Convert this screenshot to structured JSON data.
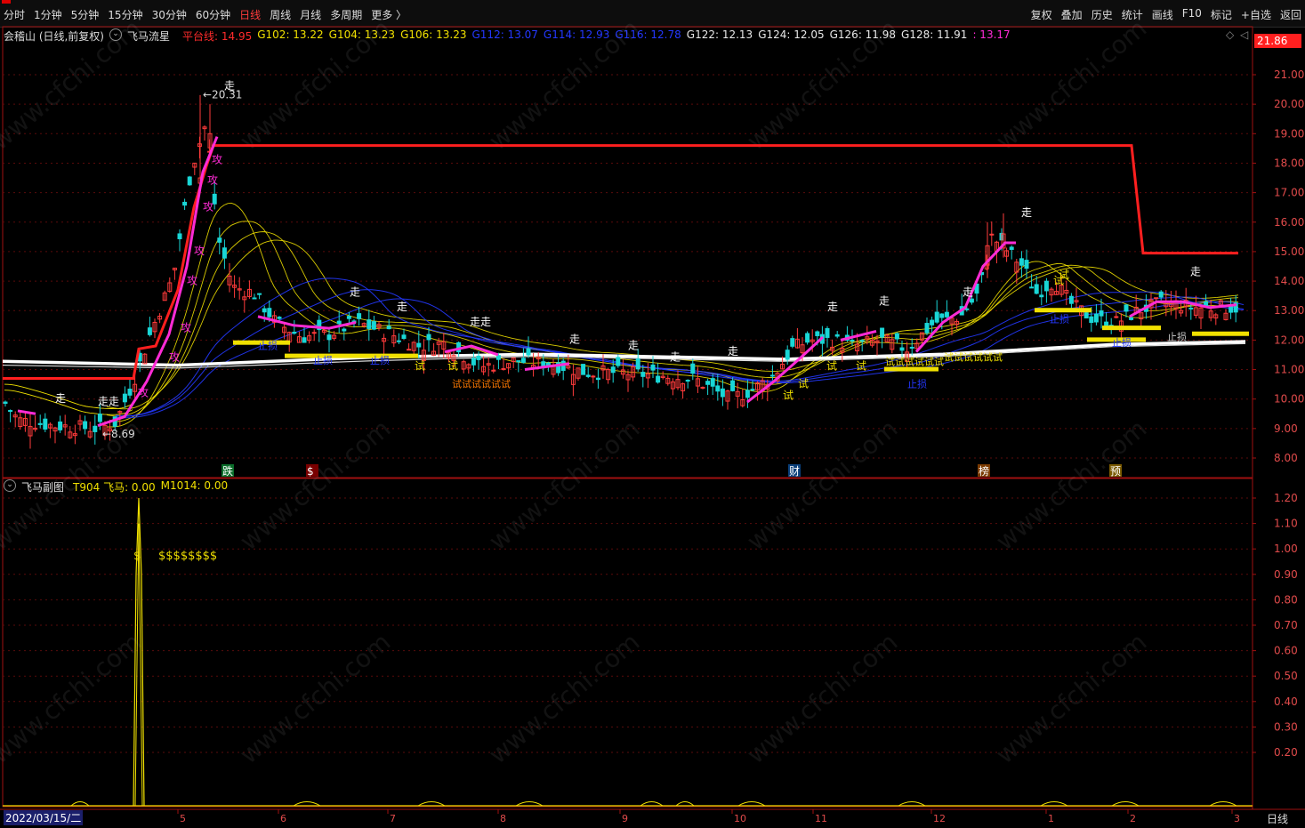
{
  "toolbar": {
    "left": [
      "分时",
      "1分钟",
      "5分钟",
      "15分钟",
      "30分钟",
      "60分钟",
      "日线",
      "周线",
      "月线",
      "多周期",
      "更多 〉"
    ],
    "active": "日线",
    "right": [
      "复权",
      "叠加",
      "历史",
      "统计",
      "画线",
      "F10",
      "标记",
      "+自选",
      "返回"
    ]
  },
  "main_info": {
    "stock": "会稽山 (日线,前复权)",
    "indicator": "飞马流星",
    "platform_label": "平台线: 14.95",
    "g_values": [
      {
        "text": "G102: 13.22",
        "color": "#f0e000"
      },
      {
        "text": "G104: 13.23",
        "color": "#f0e000"
      },
      {
        "text": "G106: 13.23",
        "color": "#f0e000"
      },
      {
        "text": "G112: 13.07",
        "color": "#2438ff"
      },
      {
        "text": "G114: 12.93",
        "color": "#2438ff"
      },
      {
        "text": "G116: 12.78",
        "color": "#2438ff"
      },
      {
        "text": "G122: 12.13",
        "color": "#e8e8e8"
      },
      {
        "text": "G124: 12.05",
        "color": "#e8e8e8"
      },
      {
        "text": "G126: 11.98",
        "color": "#e8e8e8"
      },
      {
        "text": "G128: 11.91",
        "color": "#e8e8e8"
      },
      {
        "text": ": 13.17",
        "color": "#ff2bd6"
      }
    ],
    "current_price": "21.86"
  },
  "sub_info": {
    "title": "飞马副图",
    "t904": "T904 飞马: 0.00",
    "m1014": "M1014: 0.00"
  },
  "main_ticks": [
    "21.00",
    "20.00",
    "19.00",
    "18.00",
    "17.00",
    "16.00",
    "15.00",
    "14.00",
    "13.00",
    "12.00",
    "11.00",
    "10.00",
    "9.00",
    "8.00"
  ],
  "sub_ticks": [
    "1.20",
    "1.10",
    "1.00",
    "0.90",
    "0.80",
    "0.70",
    "0.60",
    "0.50",
    "0.40",
    "0.30",
    "0.20"
  ],
  "x_labels": [
    "5",
    "6",
    "7",
    "8",
    "9",
    "10",
    "11",
    "12",
    "1",
    "2",
    "3"
  ],
  "date": "2022/03/15/二",
  "bottom_tab": "日线",
  "annotations": {
    "high": "←20.31",
    "low": "←8.69",
    "zou": "走",
    "zouzou": "走走",
    "gong": "攻",
    "shi": "试",
    "event_die": "跌",
    "event_s": "$",
    "event_cai": "财",
    "event_bang": "榜",
    "event_yu": "预",
    "shi_seq": "试试试试试试",
    "stop_loss": "止损",
    "coin_seq": "$$$$$$$$"
  },
  "watermark": "www.cfchi.com",
  "colors": {
    "platform": "#ff1f1f",
    "rise": "#ff3b3b",
    "fall": "#19d6d6",
    "flying": "#ff2bd6",
    "white_line": "#ffffff",
    "yellow": "#f0e000",
    "blue": "#2438ff",
    "axis": "#a01010"
  }
}
